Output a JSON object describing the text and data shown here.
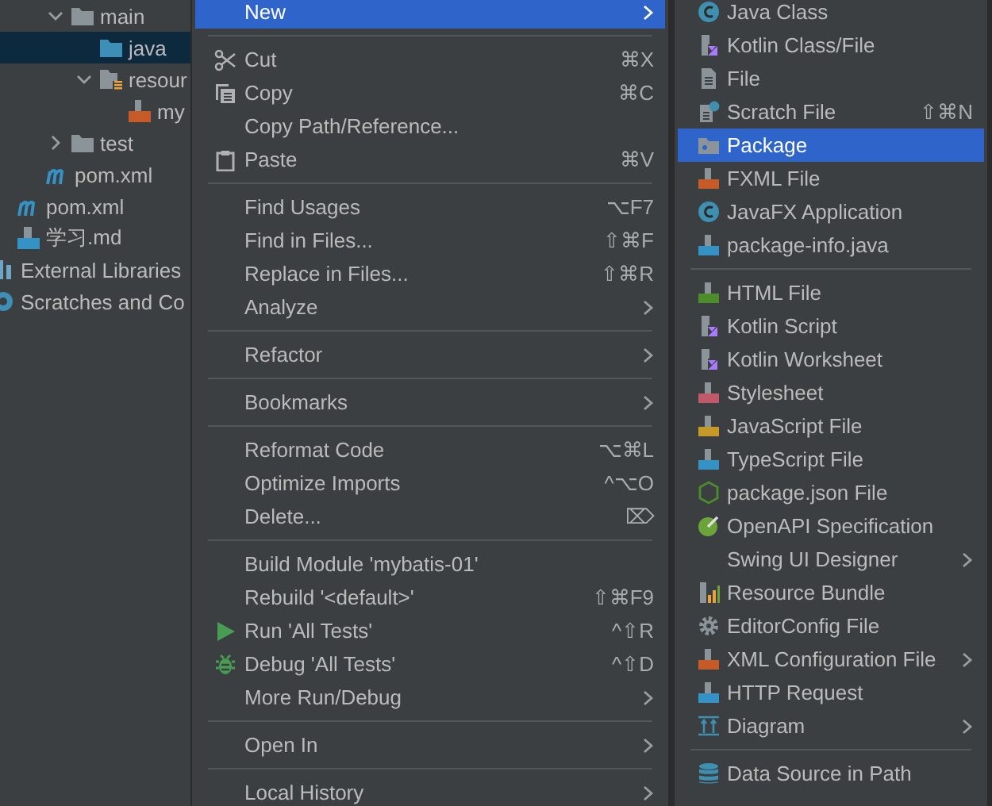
{
  "project_tree": {
    "items": [
      {
        "label": "main",
        "expanded": true,
        "selected": false,
        "children": [
          {
            "label": "java",
            "selected": true
          },
          {
            "label": "resour",
            "expanded": true,
            "selected": false,
            "children": [
              {
                "label": "my",
                "selected": false
              }
            ]
          }
        ]
      },
      {
        "label": "test",
        "expanded": false,
        "selected": false
      },
      {
        "label": "pom.xml",
        "selected": false
      },
      {
        "label": "pom.xml",
        "selected": false
      },
      {
        "label": "学习.md",
        "selected": false
      },
      {
        "label": "External Libraries",
        "selected": false
      },
      {
        "label": "Scratches and Co",
        "selected": false
      }
    ]
  },
  "context_menu": {
    "items": [
      {
        "kind": "item",
        "label": "New",
        "submenu": true,
        "selected": true
      },
      {
        "kind": "separator"
      },
      {
        "kind": "item",
        "label": "Cut",
        "shortcut": "⌘X",
        "selected": false
      },
      {
        "kind": "item",
        "label": "Copy",
        "shortcut": "⌘C",
        "selected": false
      },
      {
        "kind": "item",
        "label": "Copy Path/Reference...",
        "selected": false
      },
      {
        "kind": "item",
        "label": "Paste",
        "shortcut": "⌘V",
        "selected": false
      },
      {
        "kind": "separator"
      },
      {
        "kind": "item",
        "label": "Find Usages",
        "shortcut": "⌥F7",
        "selected": false
      },
      {
        "kind": "item",
        "label": "Find in Files...",
        "shortcut": "⇧⌘F",
        "selected": false
      },
      {
        "kind": "item",
        "label": "Replace in Files...",
        "shortcut": "⇧⌘R",
        "selected": false
      },
      {
        "kind": "item",
        "label": "Analyze",
        "submenu": true,
        "selected": false
      },
      {
        "kind": "separator"
      },
      {
        "kind": "item",
        "label": "Refactor",
        "submenu": true,
        "selected": false
      },
      {
        "kind": "separator"
      },
      {
        "kind": "item",
        "label": "Bookmarks",
        "submenu": true,
        "selected": false
      },
      {
        "kind": "separator"
      },
      {
        "kind": "item",
        "label": "Reformat Code",
        "shortcut": "⌥⌘L",
        "selected": false
      },
      {
        "kind": "item",
        "label": "Optimize Imports",
        "shortcut": "^⌥O",
        "selected": false
      },
      {
        "kind": "item",
        "label": "Delete...",
        "shortcut": "⌦",
        "selected": false
      },
      {
        "kind": "separator"
      },
      {
        "kind": "item",
        "label": "Build Module 'mybatis-01'",
        "selected": false
      },
      {
        "kind": "item",
        "label": "Rebuild '<default>'",
        "shortcut": "⇧⌘F9",
        "selected": false
      },
      {
        "kind": "item",
        "label": "Run 'All Tests'",
        "shortcut": "^⇧R",
        "selected": false
      },
      {
        "kind": "item",
        "label": "Debug 'All Tests'",
        "shortcut": "^⇧D",
        "selected": false
      },
      {
        "kind": "item",
        "label": "More Run/Debug",
        "submenu": true,
        "selected": false
      },
      {
        "kind": "separator"
      },
      {
        "kind": "item",
        "label": "Open In",
        "submenu": true,
        "selected": false
      },
      {
        "kind": "separator"
      },
      {
        "kind": "item",
        "label": "Local History",
        "submenu": true,
        "selected": false
      }
    ]
  },
  "new_submenu": {
    "items": [
      {
        "kind": "item",
        "label": "Java Class",
        "selected": false
      },
      {
        "kind": "item",
        "label": "Kotlin Class/File",
        "selected": false
      },
      {
        "kind": "item",
        "label": "File",
        "selected": false
      },
      {
        "kind": "item",
        "label": "Scratch File",
        "shortcut": "⇧⌘N",
        "selected": false
      },
      {
        "kind": "item",
        "label": "Package",
        "selected": true
      },
      {
        "kind": "item",
        "label": "FXML File",
        "selected": false
      },
      {
        "kind": "item",
        "label": "JavaFX Application",
        "selected": false
      },
      {
        "kind": "item",
        "label": "package-info.java",
        "selected": false
      },
      {
        "kind": "separator"
      },
      {
        "kind": "item",
        "label": "HTML File",
        "selected": false
      },
      {
        "kind": "item",
        "label": "Kotlin Script",
        "selected": false
      },
      {
        "kind": "item",
        "label": "Kotlin Worksheet",
        "selected": false
      },
      {
        "kind": "item",
        "label": "Stylesheet",
        "selected": false
      },
      {
        "kind": "item",
        "label": "JavaScript File",
        "selected": false
      },
      {
        "kind": "item",
        "label": "TypeScript File",
        "selected": false
      },
      {
        "kind": "item",
        "label": "package.json File",
        "selected": false
      },
      {
        "kind": "item",
        "label": "OpenAPI Specification",
        "selected": false
      },
      {
        "kind": "item",
        "label": "Swing UI Designer",
        "submenu": true,
        "selected": false
      },
      {
        "kind": "item",
        "label": "Resource Bundle",
        "selected": false
      },
      {
        "kind": "item",
        "label": "EditorConfig File",
        "selected": false
      },
      {
        "kind": "item",
        "label": "XML Configuration File",
        "submenu": true,
        "selected": false
      },
      {
        "kind": "item",
        "label": "HTTP Request",
        "selected": false
      },
      {
        "kind": "item",
        "label": "Diagram",
        "submenu": true,
        "selected": false
      },
      {
        "kind": "separator"
      },
      {
        "kind": "item",
        "label": "Data Source in Path",
        "selected": false
      }
    ]
  }
}
